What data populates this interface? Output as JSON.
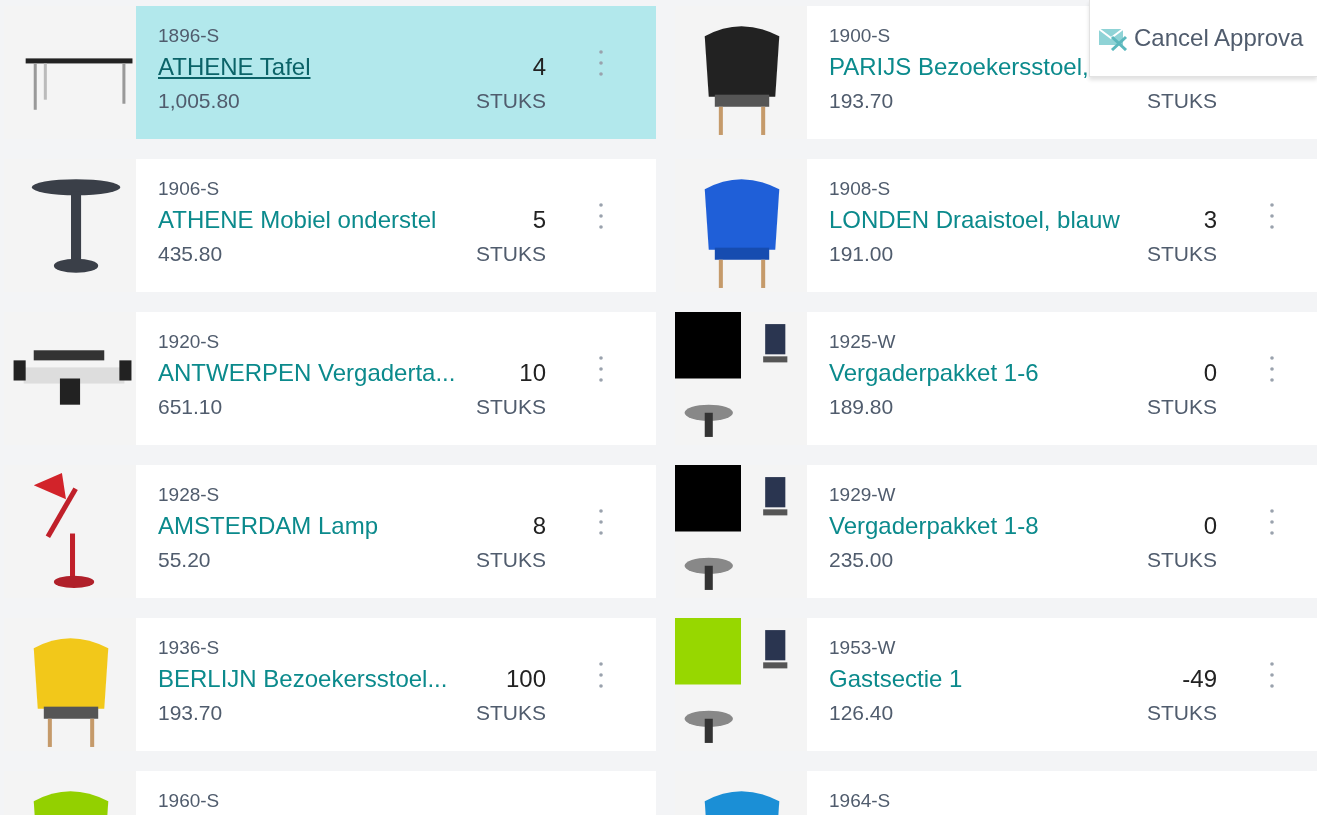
{
  "items": [
    {
      "number": "1896-S",
      "title": "ATHENE Tafel",
      "quantity": "4",
      "price": "1,005.80",
      "unit": "STUKS",
      "selected": true
    },
    {
      "number": "1900-S",
      "title": "PARIJS Bezoekersstoel,",
      "price": "193.70",
      "unit": "STUKS",
      "selected": false
    },
    {
      "number": "1906-S",
      "title": "ATHENE Mobiel onderstel",
      "quantity": "5",
      "price": "435.80",
      "unit": "STUKS",
      "selected": false
    },
    {
      "number": "1908-S",
      "title": "LONDEN Draaistoel, blauw",
      "quantity": "3",
      "price": "191.00",
      "unit": "STUKS",
      "selected": false
    },
    {
      "number": "1920-S",
      "title": "ANTWERPEN Vergaderta...",
      "quantity": "10",
      "price": "651.10",
      "unit": "STUKS",
      "selected": false
    },
    {
      "number": "1925-W",
      "title": "Vergaderpakket 1-6",
      "quantity": "0",
      "price": "189.80",
      "unit": "STUKS",
      "selected": false
    },
    {
      "number": "1928-S",
      "title": "AMSTERDAM Lamp",
      "quantity": "8",
      "price": "55.20",
      "unit": "STUKS",
      "selected": false
    },
    {
      "number": "1929-W",
      "title": "Vergaderpakket 1-8",
      "quantity": "0",
      "price": "235.00",
      "unit": "STUKS",
      "selected": false
    },
    {
      "number": "1936-S",
      "title": "BERLIJN Bezoekersstoel...",
      "quantity": "100",
      "price": "193.70",
      "unit": "STUKS",
      "selected": false
    },
    {
      "number": "1953-W",
      "title": "Gastsectie 1",
      "quantity": "-49",
      "price": "126.40",
      "unit": "STUKS",
      "selected": false
    },
    {
      "number": "1960-S",
      "selected": false
    },
    {
      "number": "1964-S",
      "selected": false
    }
  ],
  "action_popup": {
    "label": "Cancel Approva"
  }
}
